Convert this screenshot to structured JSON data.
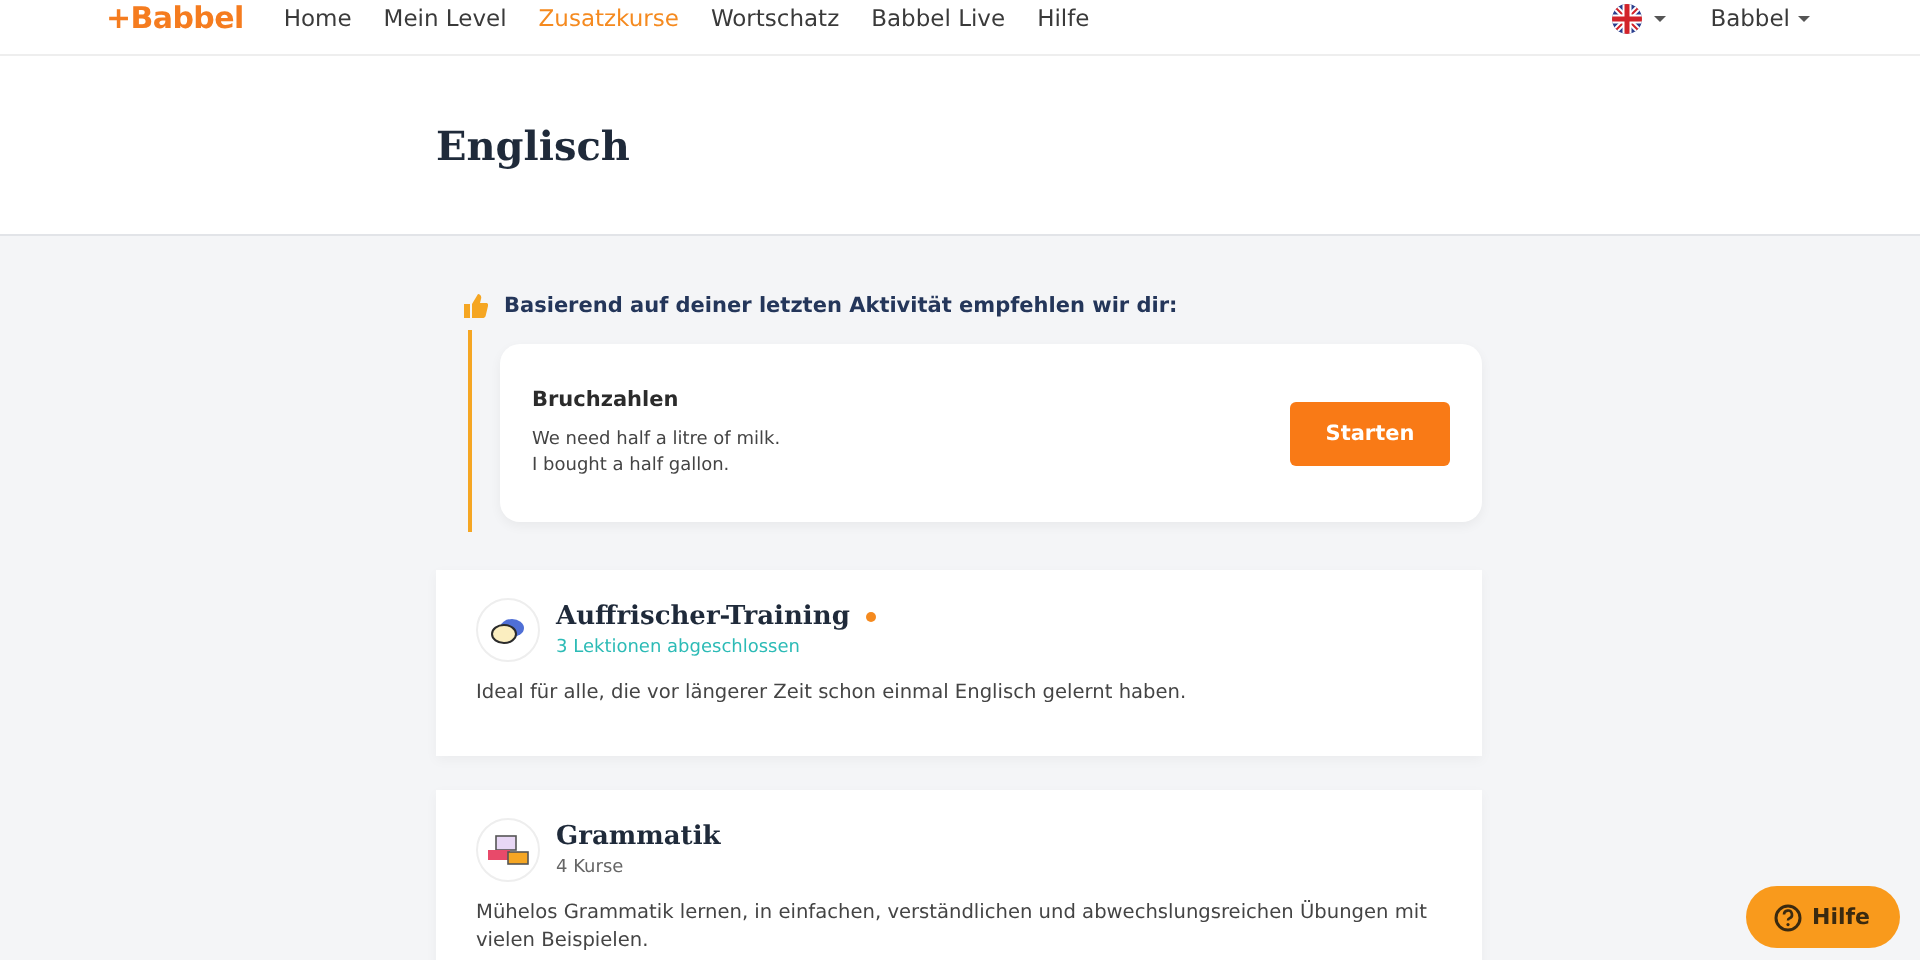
{
  "nav": {
    "logo": "+Babbel",
    "items": [
      {
        "label": "Home",
        "selected": false
      },
      {
        "label": "Mein Level",
        "selected": false
      },
      {
        "label": "Zusatzkurse",
        "selected": true
      },
      {
        "label": "Wortschatz",
        "selected": false
      },
      {
        "label": "Babbel Live",
        "selected": false
      },
      {
        "label": "Hilfe",
        "selected": false
      }
    ],
    "account": "Babbel"
  },
  "header": {
    "title": "Englisch"
  },
  "recommendation": {
    "heading": "Basierend auf deiner letzten Aktivität empfehlen wir dir:",
    "title": "Bruchzahlen",
    "lines": [
      "We need half a litre of milk.",
      "I bought a half gallon."
    ],
    "button": "Starten"
  },
  "courses": [
    {
      "title": "Auffrischer-Training",
      "new": true,
      "kind": "progress",
      "subtitle": "3 Lektionen abgeschlossen",
      "description": "Ideal für alle, die vor längerer Zeit schon einmal Englisch gelernt haben."
    },
    {
      "title": "Grammatik",
      "new": false,
      "kind": "count",
      "subtitle": "4 Kurse",
      "description": "Mühelos Grammatik lernen, in einfachen, verständlichen und abwechslungsreichen Übungen mit vielen Beispielen."
    }
  ],
  "help_button": "Hilfe"
}
